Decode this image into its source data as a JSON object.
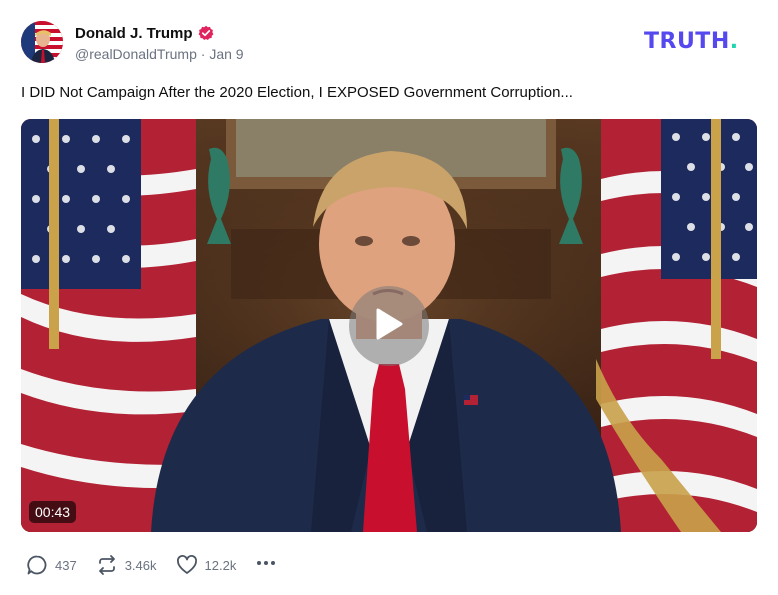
{
  "author": {
    "display_name": "Donald J. Trump",
    "verified": true,
    "handle": "@realDonaldTrump",
    "separator": "·",
    "date": "Jan 9"
  },
  "brand": {
    "logo_text": "TRUTH",
    "logo_dot": ".",
    "logo_color": "#5448ee",
    "dot_color": "#1fd6b0"
  },
  "post": {
    "text": "I DID Not Campaign After the 2020 Election, I EXPOSED Government Corruption..."
  },
  "video": {
    "duration": "00:43"
  },
  "actions": {
    "replies": "437",
    "retruths": "3.46k",
    "likes": "12.2k"
  },
  "icons": {
    "verified": "verified-badge-icon",
    "reply": "speech-bubble-icon",
    "retruth": "repost-arrows-icon",
    "like": "heart-icon",
    "more": "ellipsis-icon",
    "play": "play-icon"
  }
}
